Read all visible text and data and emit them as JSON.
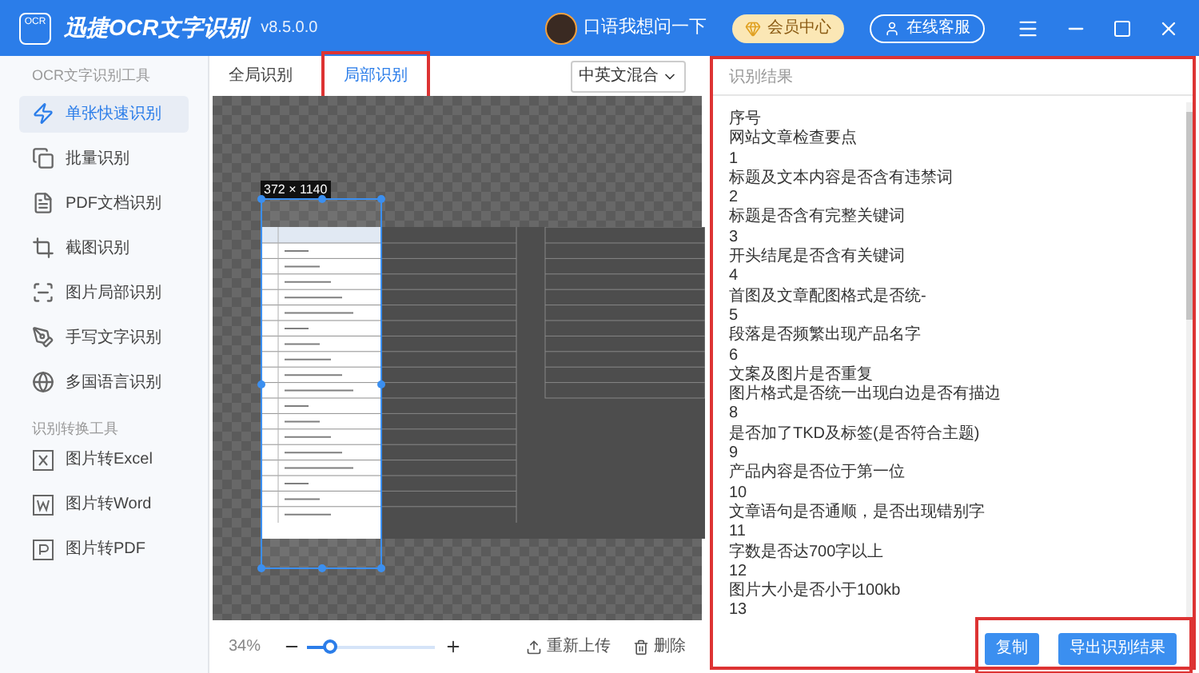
{
  "app": {
    "logo": "OCR",
    "title": "迅捷OCR文字识别",
    "version": "v8.5.0.0",
    "user": "口语我想问一下",
    "vip_button": "会员中心",
    "support_button": "在线客服"
  },
  "sidebar": {
    "sections": [
      {
        "heading": "OCR文字识别工具",
        "items": [
          {
            "label": "单张快速识别",
            "kind": "bolt",
            "selected": true
          },
          {
            "label": "批量识别",
            "kind": "stack",
            "selected": false
          },
          {
            "label": "PDF文档识别",
            "kind": "pdf",
            "selected": false
          },
          {
            "label": "截图识别",
            "kind": "crop",
            "selected": false
          },
          {
            "label": "图片局部识别",
            "kind": "scan",
            "selected": false
          },
          {
            "label": "手写文字识别",
            "kind": "pen",
            "selected": false
          },
          {
            "label": "多国语言识别",
            "kind": "globe",
            "selected": false
          }
        ]
      },
      {
        "heading": "识别转换工具",
        "items": [
          {
            "label": "图片转Excel",
            "kind": "x",
            "selected": false
          },
          {
            "label": "图片转Word",
            "kind": "w",
            "selected": false
          },
          {
            "label": "图片转PDF",
            "kind": "p",
            "selected": false
          }
        ]
      }
    ]
  },
  "tabs": [
    {
      "label": "全局识别",
      "selected": false
    },
    {
      "label": "局部识别",
      "selected": true
    }
  ],
  "language_select": {
    "value": "中英文混合"
  },
  "canvas": {
    "selection_size": "372 × 1140"
  },
  "zoom": {
    "reading": "34%",
    "level": 0.17
  },
  "canvas_actions": [
    "重新上传",
    "删除"
  ],
  "result": {
    "title": "识别结果",
    "lines": [
      "序号",
      "网站文章检查要点",
      "1",
      "标题及文本内容是否含有违禁词",
      "2",
      "标题是否含有完整关键词",
      "3",
      "开头结尾是否含有关键词",
      "4",
      "首图及文章配图格式是否统-",
      "5",
      "段落是否频繁出现产品名字",
      "6",
      "文案及图片是否重复",
      "图片格式是否统一出现白边是否有描边",
      "8",
      "是否加了TKD及标签(是否符合主题)",
      "9",
      "产品内容是否位于第一位",
      "10",
      "文章语句是否通顺，是否出现错别字",
      "11",
      "字数是否达700字以上",
      "12",
      "图片大小是否小于100kb",
      "13"
    ],
    "buttons": [
      "复制",
      "导出识别结果"
    ]
  }
}
